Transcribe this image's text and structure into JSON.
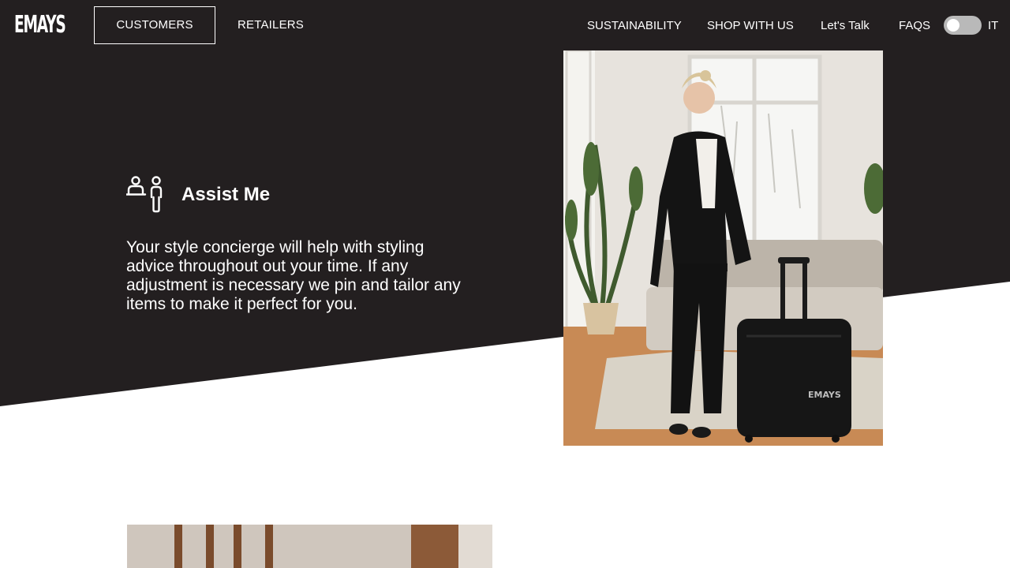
{
  "brand": {
    "logo_text": "EMAYS"
  },
  "nav": {
    "tabs": [
      {
        "label": "CUSTOMERS",
        "active": true
      },
      {
        "label": "RETAILERS",
        "active": false
      }
    ],
    "links": [
      "SUSTAINABILITY",
      "SHOP WITH US",
      "Let's Talk",
      "FAQS"
    ],
    "language_toggle": {
      "label": "IT",
      "on": false
    }
  },
  "feature": {
    "icon": "people-assist-icon",
    "title": "Assist Me",
    "description": "Your style concierge will help with styling advice throughout out your time. If any adjustment is necessary we pin and tailor any items to make it perfect for you."
  },
  "images": {
    "main": {
      "subject": "woman-with-suitcase-photo",
      "luggage_brand_text": "EMAYS"
    },
    "secondary": {
      "subject": "interior-photo"
    }
  },
  "colors": {
    "dark_bg": "#231f20",
    "text_light": "#ffffff",
    "toggle_track": "#b9b9b9"
  }
}
